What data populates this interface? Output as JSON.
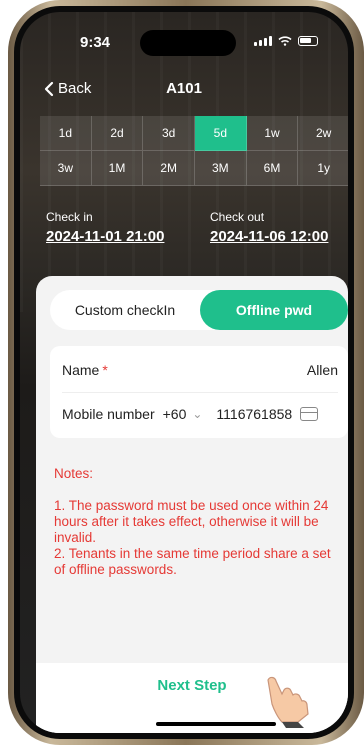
{
  "status": {
    "time": "9:34"
  },
  "nav": {
    "back_label": "Back",
    "title": "A101"
  },
  "durations": [
    {
      "label": "1d",
      "active": false
    },
    {
      "label": "2d",
      "active": false
    },
    {
      "label": "3d",
      "active": false
    },
    {
      "label": "5d",
      "active": true
    },
    {
      "label": "1w",
      "active": false
    },
    {
      "label": "2w",
      "active": false
    },
    {
      "label": "3w",
      "active": false
    },
    {
      "label": "1M",
      "active": false
    },
    {
      "label": "2M",
      "active": false
    },
    {
      "label": "3M",
      "active": false
    },
    {
      "label": "6M",
      "active": false
    },
    {
      "label": "1y",
      "active": false
    }
  ],
  "checkin": {
    "label": "Check in",
    "value": "2024-11-01 21:00"
  },
  "checkout": {
    "label": "Check out",
    "value": "2024-11-06 12:00"
  },
  "tabs": {
    "left": "Custom checkIn",
    "right": "Offline pwd"
  },
  "form": {
    "name_label": "Name",
    "required_mark": "*",
    "name_value": "Allen",
    "mobile_label": "Mobile number",
    "country_code": "+60",
    "mobile_value": "1116761858"
  },
  "notes": {
    "title": "Notes:",
    "line1": "1. The password must be used once within 24 hours after it takes effect, otherwise it will be invalid.",
    "line2": "2. Tenants in the same time period share a set of offline passwords."
  },
  "footer": {
    "next_label": "Next Step"
  },
  "colors": {
    "accent": "#1fbf8c",
    "warning": "#e53935"
  }
}
